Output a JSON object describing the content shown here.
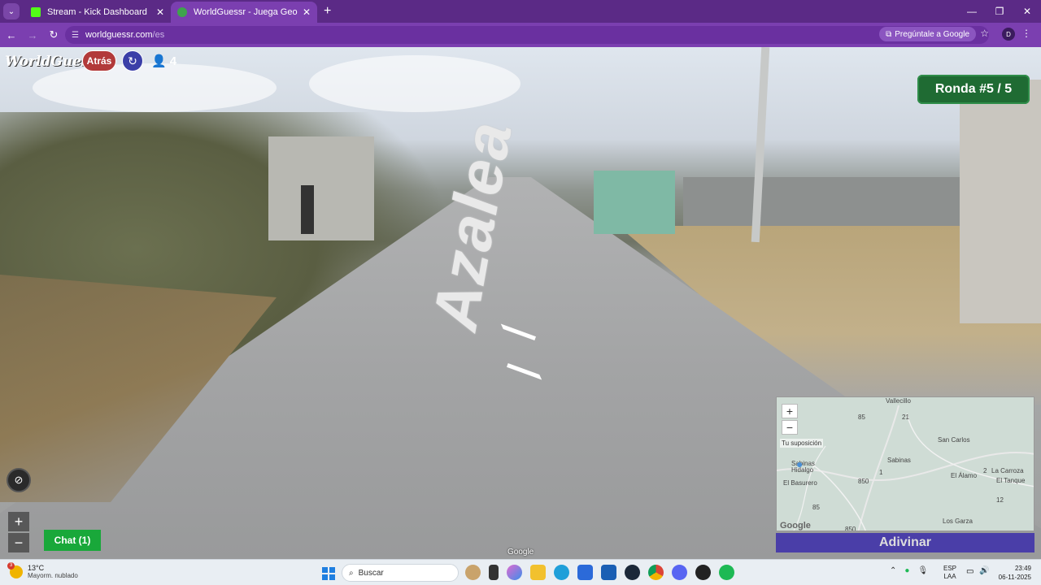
{
  "browser": {
    "tabs": [
      {
        "title": "Stream - Kick Dashboard",
        "color": "#53fc18"
      },
      {
        "title": "WorldGuessr - Juega GeoGuessr",
        "color": "#3fa34d"
      }
    ],
    "url_host": "worldguessr.com",
    "url_path": "/es",
    "ask_google": "Pregúntale a Google",
    "profile_initial": "D"
  },
  "game": {
    "logo": "WorldGuessr",
    "back_label": "Atrás",
    "players_count": "4",
    "round_label": "Ronda #5 / 5",
    "road_text": "Azalea",
    "chat_label": "Chat (1)",
    "google_watermark": "Google",
    "map": {
      "guess_hint": "Tu suposición",
      "places": [
        "Vallecillo",
        "San Carlos",
        "Sabinas",
        "Sabinas Hidalgo",
        "El Álamo",
        "La Carroza",
        "El Tanque",
        "El Basurero",
        "Los Garza"
      ],
      "route_numbers": [
        "85",
        "21",
        "850",
        "1",
        "2",
        "85",
        "850",
        "12"
      ],
      "google_logo": "Google"
    },
    "guess_button": "Adivinar"
  },
  "taskbar": {
    "temperature": "13°C",
    "weather_desc": "Mayorm. nublado",
    "weather_badge": "3",
    "search_placeholder": "Buscar",
    "lang_top": "ESP",
    "lang_bottom": "LAA",
    "time": "23:49",
    "date": "06-11-2025"
  }
}
